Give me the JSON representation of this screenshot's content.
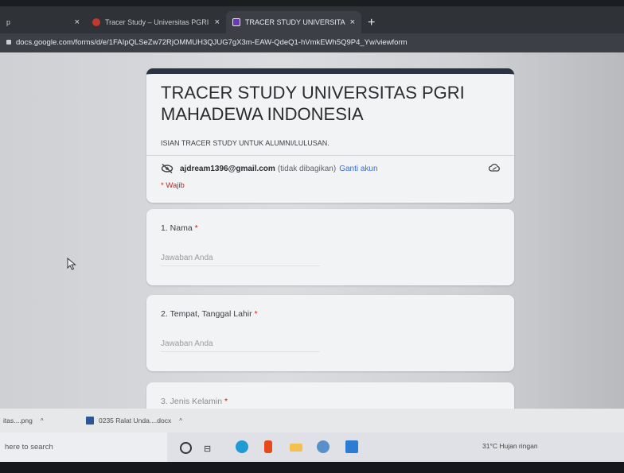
{
  "browser": {
    "tabs": [
      {
        "title": "p",
        "active": false
      },
      {
        "title": "Tracer Study – Universitas PGRI M",
        "active": false
      },
      {
        "title": "TRACER STUDY UNIVERSITAS PGI",
        "active": true
      }
    ],
    "new_tab_symbol": "+",
    "close_symbol": "×",
    "url": "docs.google.com/forms/d/e/1FAIpQLSeZw72RjOMMUH3QJUG7gX3m-EAW-QdeQ1-hVmkEWh5Q9P4_Yw/viewform"
  },
  "form": {
    "title": "TRACER STUDY UNIVERSITAS PGRI MAHADEWA INDONESIA",
    "description": "ISIAN TRACER STUDY UNTUK ALUMNI/LULUSAN.",
    "account_email": "ajdream1396@gmail.com",
    "account_note": "(tidak dibagikan)",
    "switch_account": "Ganti akun",
    "required_note": "* Wajib",
    "questions": [
      {
        "label": "1. Nama",
        "required_mark": "*",
        "placeholder": "Jawaban Anda"
      },
      {
        "label": "2. Tempat, Tanggal Lahir",
        "required_mark": "*",
        "placeholder": "Jawaban Anda"
      },
      {
        "label": "3. Jenis Kelamin",
        "required_mark": "*"
      }
    ]
  },
  "downloads": [
    {
      "name": "itas....png"
    },
    {
      "name": "0235 Ralat Unda....docx"
    }
  ],
  "taskbar": {
    "search_placeholder": "here to search",
    "tray_text": "31°C  Hujan ringan"
  },
  "colors": {
    "form_header_bar": "#2b3442",
    "required": "#c5221f",
    "link": "#3b6bd6"
  }
}
